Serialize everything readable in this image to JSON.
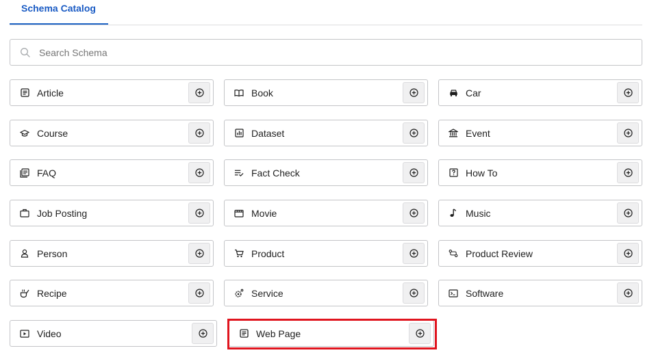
{
  "tabs": [
    {
      "label": "Schema Catalog",
      "active": true
    }
  ],
  "search": {
    "placeholder": "Search Schema",
    "value": ""
  },
  "colors": {
    "accent": "#1a5bc4",
    "highlight": "#e0141e",
    "border": "#c3c4c7",
    "button_bg": "#f0f0f1"
  },
  "schemas": [
    {
      "label": "Article",
      "icon": "article-icon"
    },
    {
      "label": "Book",
      "icon": "book-icon"
    },
    {
      "label": "Car",
      "icon": "car-icon"
    },
    {
      "label": "Course",
      "icon": "course-icon"
    },
    {
      "label": "Dataset",
      "icon": "dataset-icon"
    },
    {
      "label": "Event",
      "icon": "event-icon"
    },
    {
      "label": "FAQ",
      "icon": "faq-icon"
    },
    {
      "label": "Fact Check",
      "icon": "fact-check-icon"
    },
    {
      "label": "How To",
      "icon": "how-to-icon"
    },
    {
      "label": "Job Posting",
      "icon": "job-posting-icon"
    },
    {
      "label": "Movie",
      "icon": "movie-icon"
    },
    {
      "label": "Music",
      "icon": "music-icon"
    },
    {
      "label": "Person",
      "icon": "person-icon"
    },
    {
      "label": "Product",
      "icon": "product-icon"
    },
    {
      "label": "Product Review",
      "icon": "product-review-icon"
    },
    {
      "label": "Recipe",
      "icon": "recipe-icon"
    },
    {
      "label": "Service",
      "icon": "service-icon"
    },
    {
      "label": "Software",
      "icon": "software-icon"
    },
    {
      "label": "Video",
      "icon": "video-icon"
    },
    {
      "label": "Web Page",
      "icon": "web-page-icon",
      "highlighted": true
    }
  ],
  "add_button_icon": "plus-circle-icon"
}
